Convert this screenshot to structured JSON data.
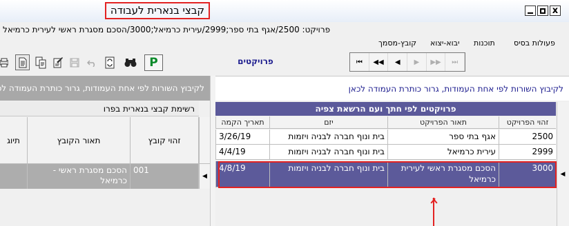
{
  "window": {
    "title": "קבצי בנארית לעבודה",
    "minimize_glyph": "",
    "maximize_glyph": "",
    "close_glyph": "x"
  },
  "path": "פרויקט: 2500/אגף בתי ספר;2999/עירית כרמיאל;3000/הסכם מסגרת ראשי לעירית כרמיאל",
  "menu": {
    "items": [
      "פעולות בסיס",
      "תוכנות",
      "יבוא-יצוא",
      "קובץ-מסמך"
    ]
  },
  "toolbar": {
    "p_label": "P",
    "icons": {
      "binoculars": "binoculars-icon",
      "refresh": "refresh-icon",
      "undo": "undo-icon",
      "save": "save-icon",
      "edit": "edit-icon",
      "copy": "copy-icon",
      "document": "document-icon",
      "print": "print-icon"
    }
  },
  "projects_label": "פרויקטים",
  "navigation": {
    "first": "⏮",
    "prev_page": "◀◀",
    "prev": "◀",
    "next": "▶",
    "next_page": "▶▶",
    "last": "⏭"
  },
  "left_panel": {
    "group_hint": "לקיבוץ השורות לפי אחת העמודות, גרור כותרת העמודה לכאן",
    "caption": "רשימת קבצי בנארית בפרו",
    "columns": {
      "id": "זהוי קובץ",
      "description": "תאור הקובץ",
      "tag": "תיוג"
    },
    "rows": [
      {
        "id": "001",
        "description": "הסכם מסגרת ראשי - כרמיאל",
        "tag": ""
      }
    ],
    "row_indicator": "◀"
  },
  "right_panel": {
    "group_hint": "לקיבוץ השורות לפי אחת העמודות, גרור כותרת העמודה לכאן",
    "caption": "פרויקטים לפי חתך ועם הרשאת צפיה",
    "columns": {
      "id": "זהוי הפרויקט",
      "description": "תאור הפרויקט",
      "developer": "יזם",
      "date": "תאריך הקמה"
    },
    "rows": [
      {
        "id": "2500",
        "description": "אגף בתי ספר",
        "developer": "בית ונוף חברה לבניה ויזמות",
        "date": "3/26/19"
      },
      {
        "id": "2999",
        "description": "עירית כרמיאל",
        "developer": "בית ונוף חברה לבניה ויזמות",
        "date": "4/4/19"
      },
      {
        "id": "3000",
        "description": "הסכם מסגרת ראשי לעירית כרמיאל",
        "developer": "בית ונוף חברה לבניה ויזמות",
        "date": "4/8/19"
      }
    ],
    "selected_row": 2,
    "row_indicator": "◀"
  },
  "colors": {
    "highlight": "#e32222",
    "selection": "#5c5a9a",
    "caption_bg": "#5b599a",
    "hint_text": "#1c1c8e",
    "p_green": "#0a8a2a"
  }
}
